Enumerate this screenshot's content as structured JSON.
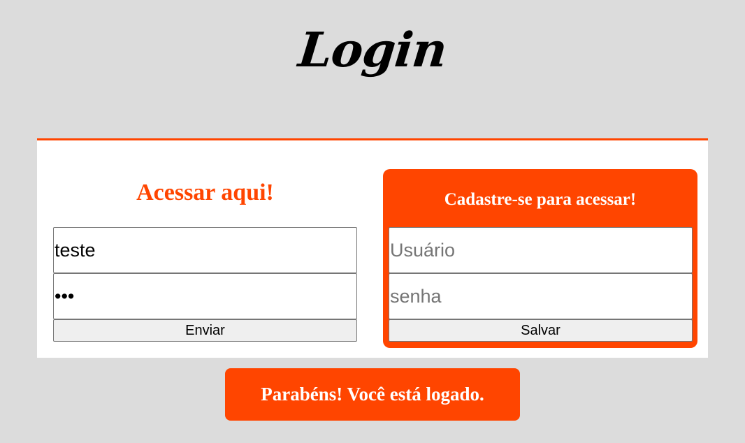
{
  "page": {
    "title": "Login"
  },
  "login": {
    "heading": "Acessar aqui!",
    "username_value": "teste",
    "password_value": "abc",
    "submit_label": "Enviar"
  },
  "signup": {
    "heading": "Cadastre-se para acessar!",
    "username_placeholder": "Usuário",
    "password_placeholder": "senha",
    "submit_label": "Salvar"
  },
  "status": {
    "message": "Parabéns! Você está logado."
  },
  "colors": {
    "accent": "#ff4500",
    "background": "#dcdcdc",
    "card": "#ffffff"
  }
}
